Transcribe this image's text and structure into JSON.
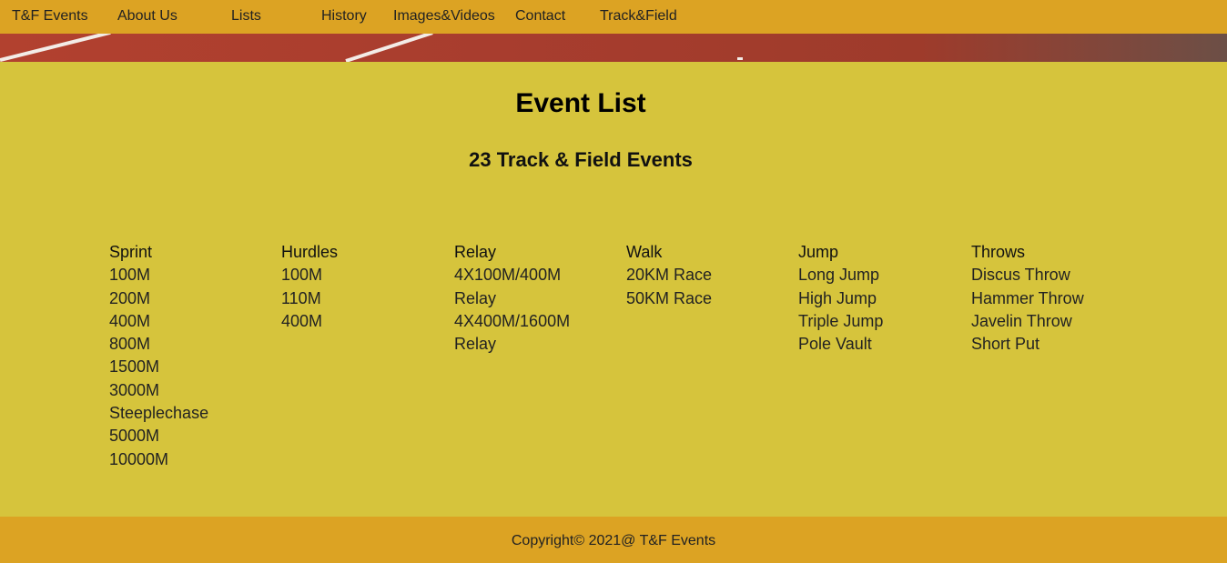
{
  "nav": {
    "items": [
      {
        "label": "T&F Events"
      },
      {
        "label": "About Us"
      },
      {
        "label": "Lists"
      },
      {
        "label": "History"
      },
      {
        "label": "Images&Videos"
      },
      {
        "label": "Contact"
      },
      {
        "label": "Track&Field"
      }
    ]
  },
  "main": {
    "title": "Event List",
    "subtitle": "23 Track & Field Events",
    "columns": [
      {
        "heading": "Sprint",
        "items": [
          "100M",
          "200M",
          "400M",
          "800M",
          "1500M",
          "3000M",
          "Steeplechase",
          "5000M",
          "10000M"
        ]
      },
      {
        "heading": "Hurdles",
        "items": [
          "100M",
          "110M",
          "400M"
        ]
      },
      {
        "heading": "Relay",
        "items": [
          "4X100M/400M",
          "Relay",
          "4X400M/1600M",
          "Relay"
        ]
      },
      {
        "heading": "Walk",
        "items": [
          "20KM Race",
          "50KM Race"
        ]
      },
      {
        "heading": "Jump",
        "items": [
          "Long Jump",
          "High Jump",
          "Triple Jump",
          "Pole Vault"
        ]
      },
      {
        "heading": "Throws",
        "items": [
          "Discus Throw",
          "Hammer Throw",
          "Javelin Throw",
          "Short Put"
        ]
      }
    ]
  },
  "footer": {
    "copyright": "Copyright© 2021@ T&F Events"
  },
  "colors": {
    "nav_bg": "#dca323",
    "main_bg": "#d6c43c",
    "track": "#a83d2e"
  }
}
